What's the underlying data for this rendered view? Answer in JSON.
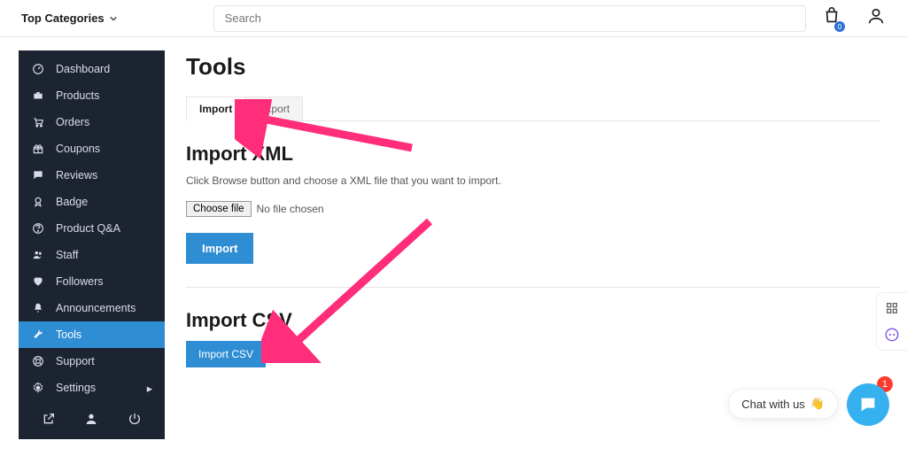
{
  "topbar": {
    "categories_label": "Top Categories",
    "search_placeholder": "Search",
    "bag_count": "0"
  },
  "sidebar": {
    "items": [
      {
        "label": "Dashboard"
      },
      {
        "label": "Products"
      },
      {
        "label": "Orders"
      },
      {
        "label": "Coupons"
      },
      {
        "label": "Reviews"
      },
      {
        "label": "Badge"
      },
      {
        "label": "Product Q&A"
      },
      {
        "label": "Staff"
      },
      {
        "label": "Followers"
      },
      {
        "label": "Announcements"
      },
      {
        "label": "Tools"
      },
      {
        "label": "Support"
      },
      {
        "label": "Settings"
      }
    ]
  },
  "main": {
    "page_title": "Tools",
    "tabs": {
      "import": "Import",
      "export": "Export"
    },
    "import_xml": {
      "heading": "Import XML",
      "help": "Click Browse button and choose a XML file that you want to import.",
      "choose_label": "Choose file",
      "no_file": "No file chosen",
      "submit": "Import"
    },
    "import_csv": {
      "heading": "Import CSV",
      "submit": "Import CSV"
    }
  },
  "chat": {
    "pill_text": "Chat with us",
    "badge": "1"
  }
}
